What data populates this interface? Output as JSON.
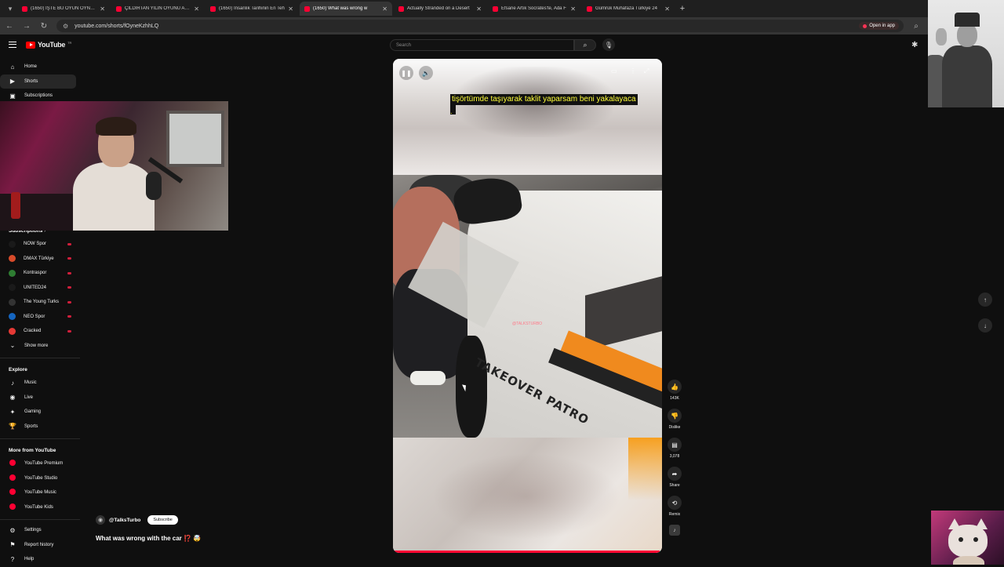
{
  "browser": {
    "tabs": [
      {
        "title": "(1650) İŞTE BU OYUN OYNANIR",
        "active": false
      },
      {
        "title": "ÇILDIRTAN YILIN OYUNU ADAM",
        "active": false
      },
      {
        "title": "(1650) İnsanlık Tarihinin En Teh",
        "active": false
      },
      {
        "title": "(1650) What was wrong w",
        "active": true
      },
      {
        "title": "Actually Stranded on a Desert",
        "active": false
      },
      {
        "title": "Efsane Artık Socrates'te, Ada F",
        "active": false
      },
      {
        "title": "Gümrük Muhafaza Türkiye 24",
        "active": false
      }
    ],
    "url": "youtube.com/shorts/fOyneKzhhLQ",
    "open_in_app": "Open in app"
  },
  "youtube": {
    "logo_text": "YouTube",
    "logo_country": "TR",
    "search_placeholder": "Search"
  },
  "sidebar": {
    "main": [
      {
        "label": "Home",
        "icon": "home-icon",
        "active": false
      },
      {
        "label": "Shorts",
        "icon": "shorts-icon",
        "active": true
      },
      {
        "label": "Subscriptions",
        "icon": "subscriptions-icon",
        "active": false
      }
    ],
    "subscriptions_header": "Subscriptions",
    "channels": [
      {
        "label": "NOW Spor",
        "color": "#1a1a1a"
      },
      {
        "label": "DMAX Türkiye",
        "color": "#d84b2a"
      },
      {
        "label": "Kontraspor",
        "color": "#2e7d32"
      },
      {
        "label": "UNITED24",
        "color": "#1a1a1a"
      },
      {
        "label": "The Young Turks",
        "color": "#333333"
      },
      {
        "label": "NEO Spor",
        "color": "#1565c0"
      },
      {
        "label": "Cracked",
        "color": "#e53935"
      }
    ],
    "show_more": "Show more",
    "explore_header": "Explore",
    "explore": [
      {
        "label": "Music",
        "icon": "music-icon"
      },
      {
        "label": "Live",
        "icon": "live-icon"
      },
      {
        "label": "Gaming",
        "icon": "gaming-icon"
      },
      {
        "label": "Sports",
        "icon": "sports-icon"
      }
    ],
    "more_header": "More from YouTube",
    "more": [
      {
        "label": "YouTube Premium"
      },
      {
        "label": "YouTube Studio"
      },
      {
        "label": "YouTube Music"
      },
      {
        "label": "YouTube Kids"
      }
    ],
    "bottom": [
      {
        "label": "Settings",
        "icon": "gear-icon"
      },
      {
        "label": "Report history",
        "icon": "flag-icon"
      },
      {
        "label": "Help",
        "icon": "help-icon"
      }
    ]
  },
  "video": {
    "subtitle": "tişörtümde taşıyarak taklit yaparsam beni yakalayaca",
    "subtitle_cont": ".",
    "lettering": "TAKEOVER PATRO",
    "watermark": "@TALKSTURBO",
    "progress": 0.99,
    "channel": "@TalksTurbo",
    "subscribe": "Subscribe",
    "title": "What was wrong with the car ⁉️ 🤯"
  },
  "actions": {
    "like": "143K",
    "dislike": "Dislike",
    "comments": "3,078",
    "share": "Share",
    "remix": "Remix"
  }
}
